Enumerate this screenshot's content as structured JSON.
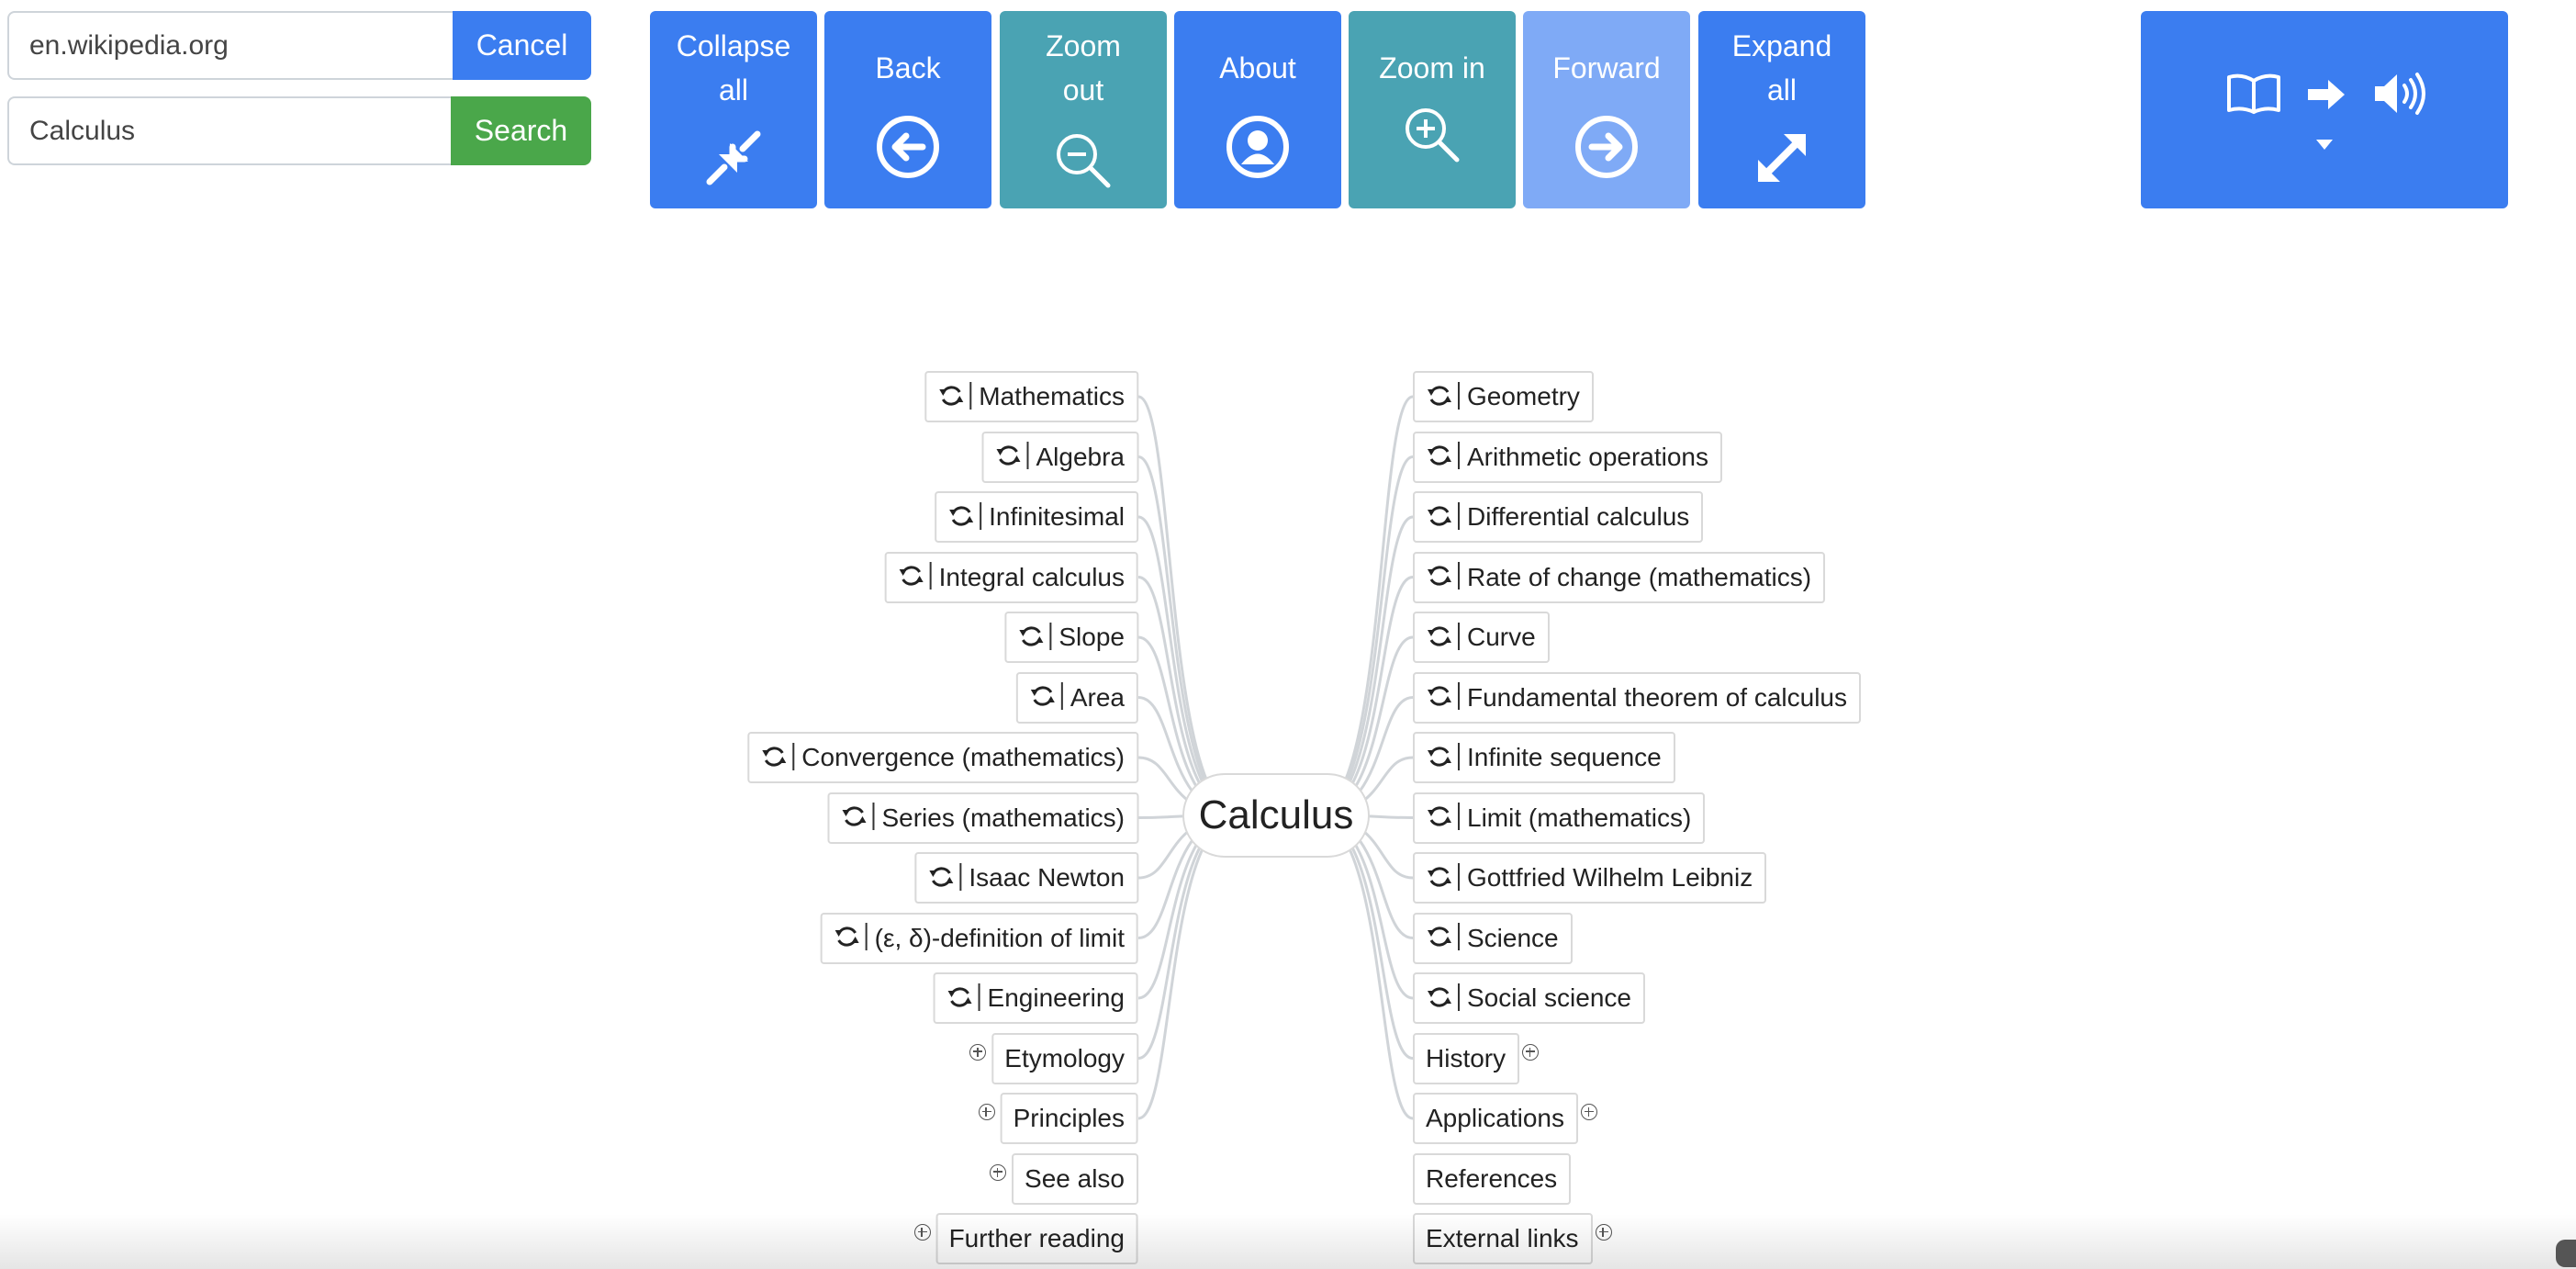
{
  "search": {
    "site_value": "en.wikipedia.org",
    "cancel_label": "Cancel",
    "query_value": "Calculus",
    "search_label": "Search"
  },
  "toolbar": {
    "collapse_all": "Collapse\nall",
    "back": "Back",
    "zoom_out": "Zoom\nout",
    "about": "About",
    "zoom_in": "Zoom in",
    "forward": "Forward",
    "expand_all": "Expand\nall"
  },
  "speech_panel": {
    "icons": [
      "book-icon",
      "arrow-right-icon",
      "speaker-icon",
      "caret-down-icon"
    ]
  },
  "mindmap": {
    "center": "Calculus",
    "left_nodes": [
      {
        "label": "Mathematics",
        "refresh": true
      },
      {
        "label": "Algebra",
        "refresh": true
      },
      {
        "label": "Infinitesimal",
        "refresh": true
      },
      {
        "label": "Integral calculus",
        "refresh": true
      },
      {
        "label": "Slope",
        "refresh": true
      },
      {
        "label": "Area",
        "refresh": true
      },
      {
        "label": "Convergence (mathematics)",
        "refresh": true
      },
      {
        "label": "Series (mathematics)",
        "refresh": true
      },
      {
        "label": "Isaac Newton",
        "refresh": true
      },
      {
        "label": "(ε, δ)-definition of limit",
        "refresh": true
      },
      {
        "label": "Engineering",
        "refresh": true
      },
      {
        "label": "Etymology",
        "expandable": true
      },
      {
        "label": "Principles",
        "expandable": true
      },
      {
        "label": "See also",
        "expandable": true
      },
      {
        "label": "Further reading",
        "expandable": true
      }
    ],
    "right_nodes": [
      {
        "label": "Geometry",
        "refresh": true
      },
      {
        "label": "Arithmetic operations",
        "refresh": true
      },
      {
        "label": "Differential calculus",
        "refresh": true
      },
      {
        "label": "Rate of change (mathematics)",
        "refresh": true
      },
      {
        "label": "Curve",
        "refresh": true
      },
      {
        "label": "Fundamental theorem of calculus",
        "refresh": true
      },
      {
        "label": "Infinite sequence",
        "refresh": true
      },
      {
        "label": "Limit (mathematics)",
        "refresh": true
      },
      {
        "label": "Gottfried Wilhelm Leibniz",
        "refresh": true
      },
      {
        "label": "Science",
        "refresh": true
      },
      {
        "label": "Social science",
        "refresh": true
      },
      {
        "label": "History",
        "expandable": true
      },
      {
        "label": "Applications",
        "expandable": true
      },
      {
        "label": "References",
        "expandable": false
      },
      {
        "label": "External links",
        "expandable": true
      }
    ]
  },
  "colors": {
    "primary": "#3b7df0",
    "teal": "#4aa3b3",
    "disabled": "#7faaf6",
    "success": "#4aa74a",
    "edge": "#d0d4d8"
  }
}
